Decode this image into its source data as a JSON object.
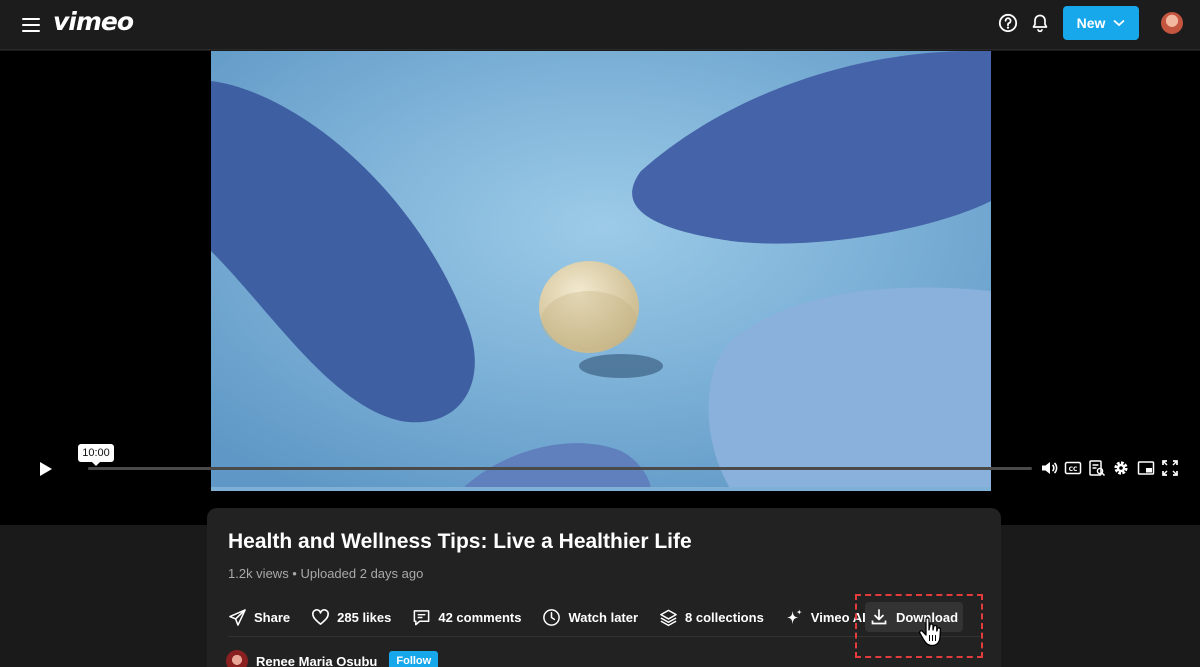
{
  "header": {
    "logo": "vimeo",
    "new_label": "New"
  },
  "player": {
    "time_tooltip": "10:00"
  },
  "video": {
    "title": "Health and Wellness Tips: Live a Healthier Life",
    "meta": "1.2k views • Uploaded 2 days ago"
  },
  "actions": {
    "share": "Share",
    "likes": "285 likes",
    "comments": "42 comments",
    "watch_later": "Watch later",
    "collections": "8 collections",
    "vimeo_ai": "Vimeo AI",
    "download": "Download"
  },
  "owner": {
    "name": "Renee Maria Osubu",
    "follow_label": "Follow"
  },
  "colors": {
    "accent": "#17a7eb",
    "highlight": "#e23c3c"
  }
}
